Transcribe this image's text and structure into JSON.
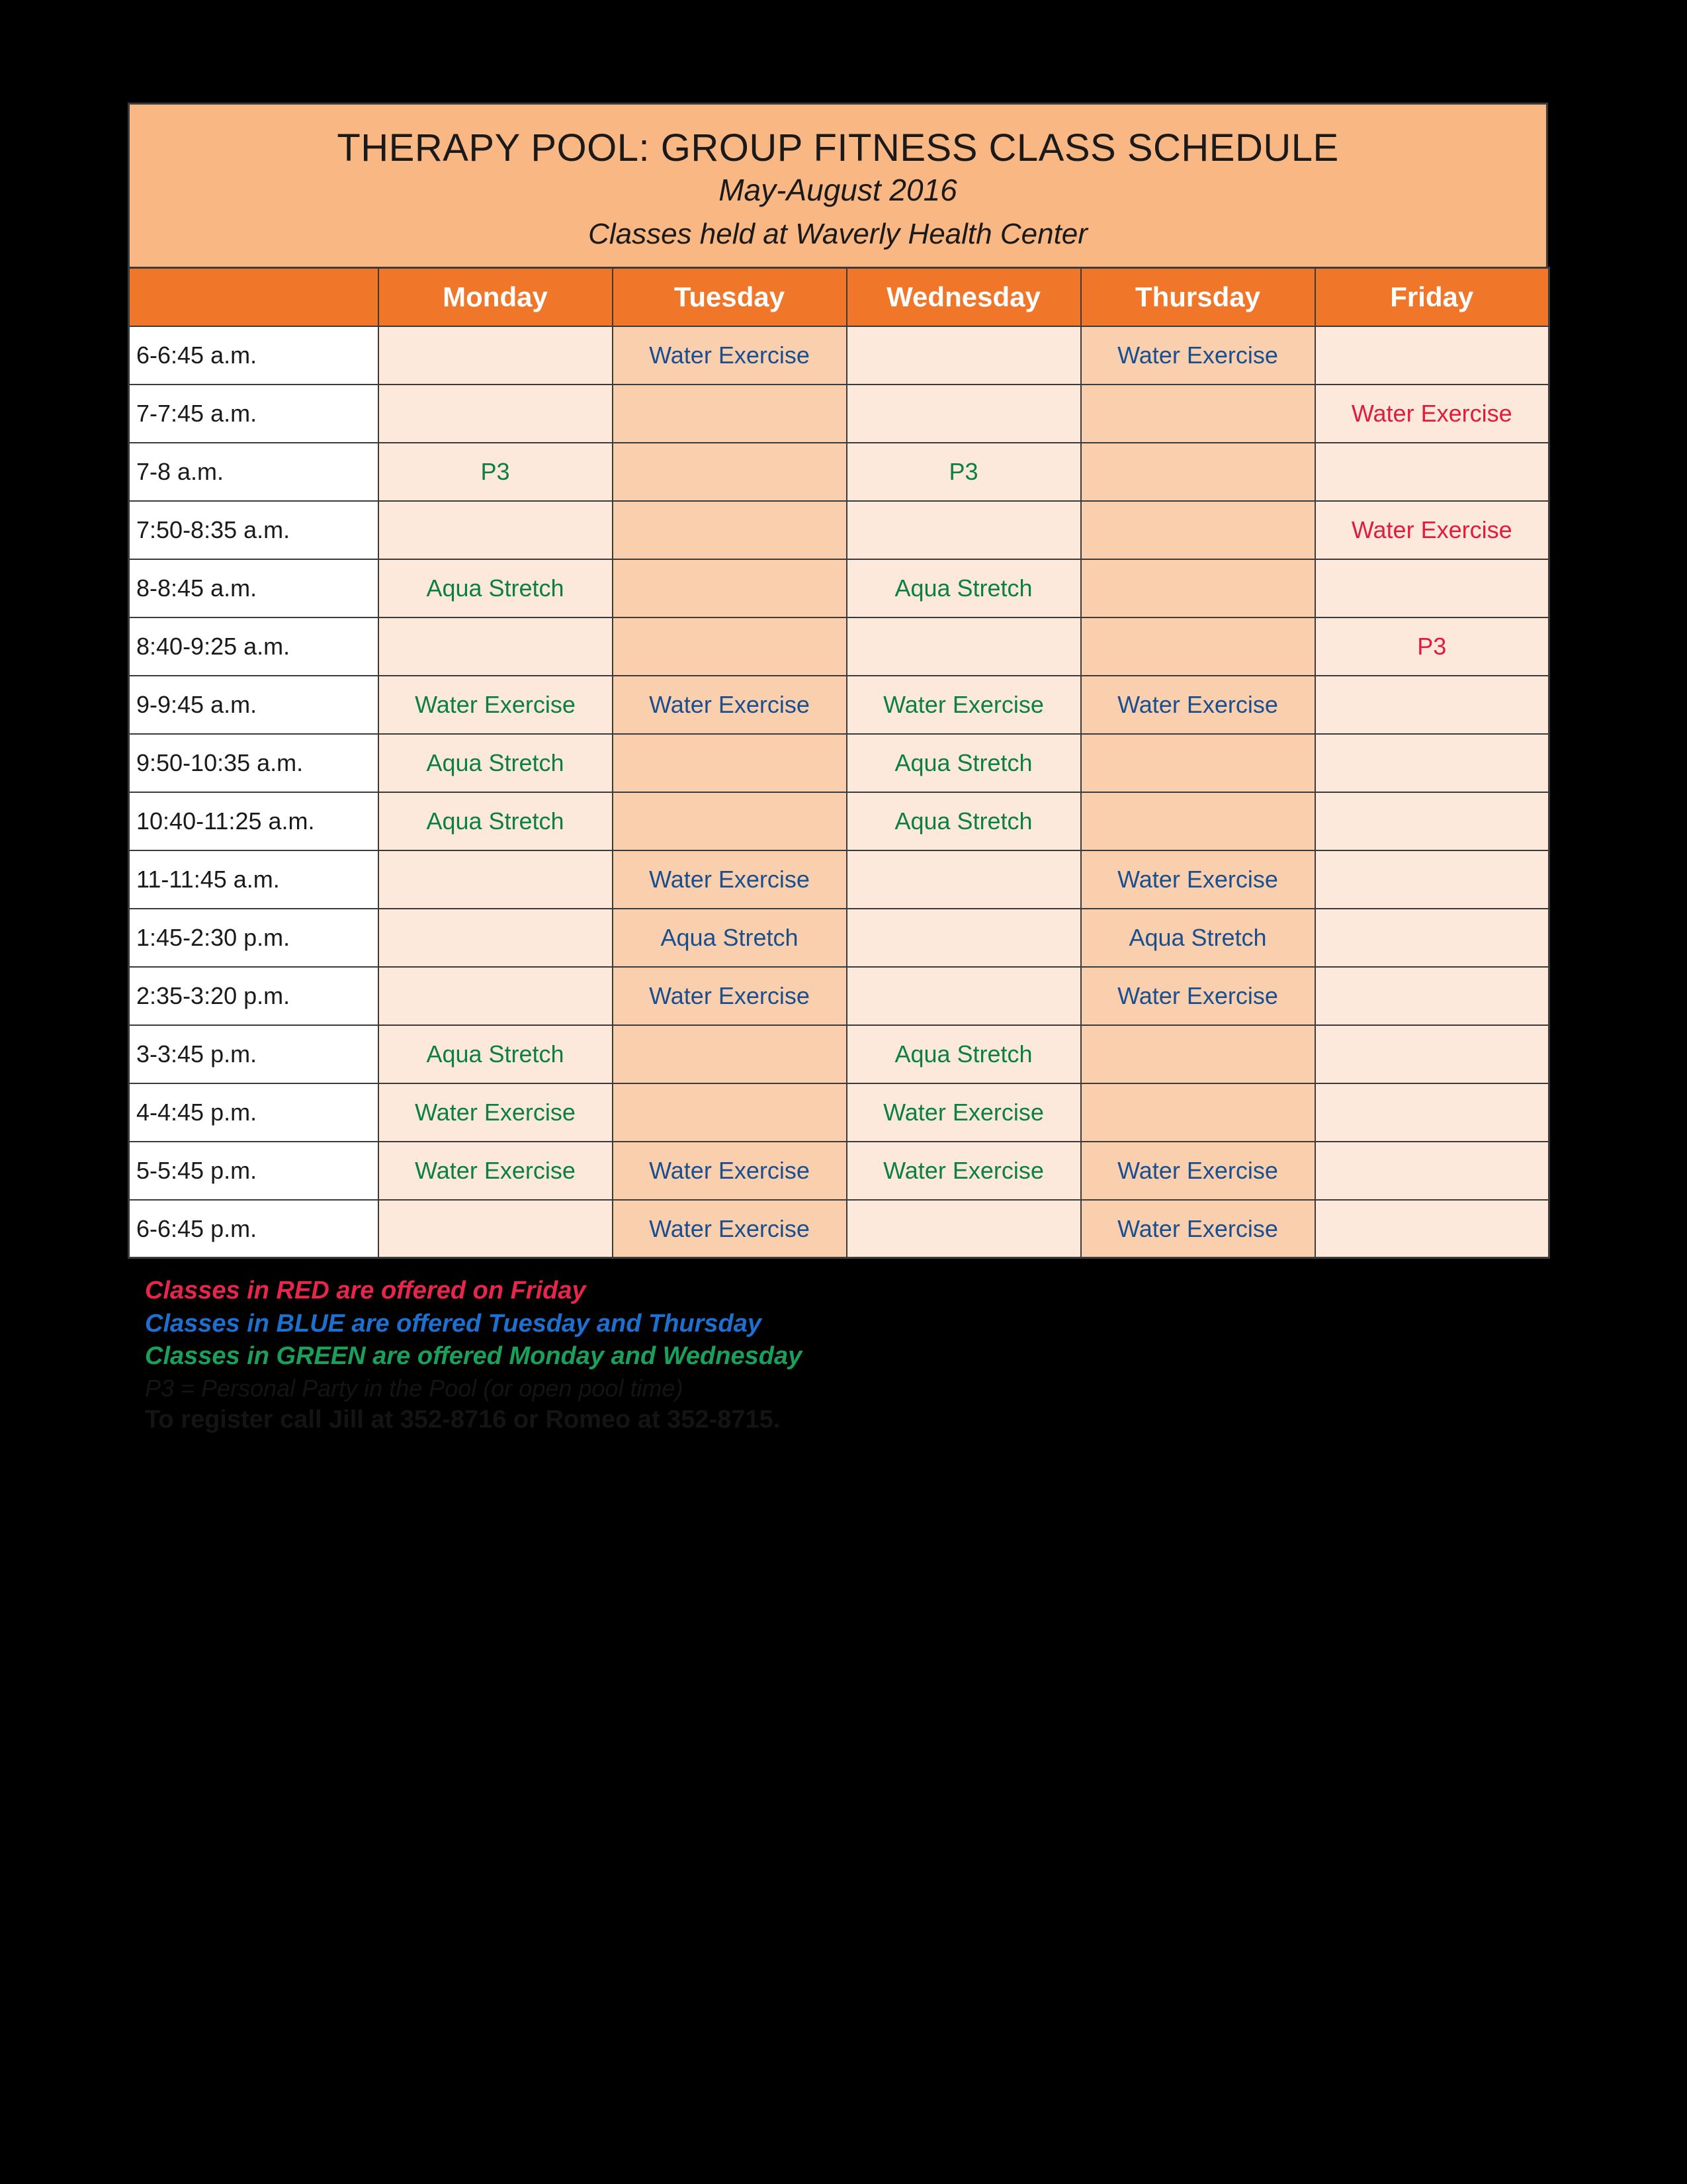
{
  "banner": {
    "title": "THERAPY POOL: GROUP FITNESS CLASS SCHEDULE",
    "subtitle": "May-August 2016",
    "location_line": "Classes held at Waverly Health Center"
  },
  "colors": {
    "banner_bg": "#F9B783",
    "header_bg": "#F0772A",
    "cell_light": "#FCE9DC",
    "cell_dark": "#FACFAE",
    "text_green": "#0B8040",
    "text_blue": "#1A4F8F",
    "text_red": "#E01B3C",
    "page_bg": "#000000"
  },
  "table": {
    "columns": [
      "",
      "Monday",
      "Tuesday",
      "Wednesday",
      "Thursday",
      "Friday"
    ],
    "rows": [
      {
        "time": "6-6:45 a.m.",
        "cells": [
          {
            "text": "",
            "color": ""
          },
          {
            "text": "Water Exercise",
            "color": "blue"
          },
          {
            "text": "",
            "color": ""
          },
          {
            "text": "Water Exercise",
            "color": "blue"
          },
          {
            "text": "",
            "color": ""
          }
        ]
      },
      {
        "time": "7-7:45 a.m.",
        "cells": [
          {
            "text": "",
            "color": ""
          },
          {
            "text": "",
            "color": ""
          },
          {
            "text": "",
            "color": ""
          },
          {
            "text": "",
            "color": ""
          },
          {
            "text": "Water Exercise",
            "color": "red"
          }
        ]
      },
      {
        "time": "7-8 a.m.",
        "cells": [
          {
            "text": "P3",
            "color": "green"
          },
          {
            "text": "",
            "color": ""
          },
          {
            "text": "P3",
            "color": "green"
          },
          {
            "text": "",
            "color": ""
          },
          {
            "text": "",
            "color": ""
          }
        ]
      },
      {
        "time": "7:50-8:35 a.m.",
        "cells": [
          {
            "text": "",
            "color": ""
          },
          {
            "text": "",
            "color": ""
          },
          {
            "text": "",
            "color": ""
          },
          {
            "text": "",
            "color": ""
          },
          {
            "text": "Water Exercise",
            "color": "red"
          }
        ]
      },
      {
        "time": "8-8:45 a.m.",
        "cells": [
          {
            "text": "Aqua Stretch",
            "color": "green"
          },
          {
            "text": "",
            "color": ""
          },
          {
            "text": "Aqua Stretch",
            "color": "green"
          },
          {
            "text": "",
            "color": ""
          },
          {
            "text": "",
            "color": ""
          }
        ]
      },
      {
        "time": "8:40-9:25 a.m.",
        "cells": [
          {
            "text": "",
            "color": ""
          },
          {
            "text": "",
            "color": ""
          },
          {
            "text": "",
            "color": ""
          },
          {
            "text": "",
            "color": ""
          },
          {
            "text": "P3",
            "color": "red"
          }
        ]
      },
      {
        "time": "9-9:45 a.m.",
        "cells": [
          {
            "text": "Water Exercise",
            "color": "green"
          },
          {
            "text": "Water Exercise",
            "color": "blue"
          },
          {
            "text": "Water Exercise",
            "color": "green"
          },
          {
            "text": "Water Exercise",
            "color": "blue"
          },
          {
            "text": "",
            "color": ""
          }
        ]
      },
      {
        "time": "9:50-10:35 a.m.",
        "cells": [
          {
            "text": "Aqua Stretch",
            "color": "green"
          },
          {
            "text": "",
            "color": ""
          },
          {
            "text": "Aqua Stretch",
            "color": "green"
          },
          {
            "text": "",
            "color": ""
          },
          {
            "text": "",
            "color": ""
          }
        ]
      },
      {
        "time": "10:40-11:25 a.m.",
        "cells": [
          {
            "text": "Aqua Stretch",
            "color": "green"
          },
          {
            "text": "",
            "color": ""
          },
          {
            "text": "Aqua Stretch",
            "color": "green"
          },
          {
            "text": "",
            "color": ""
          },
          {
            "text": "",
            "color": ""
          }
        ]
      },
      {
        "time": "11-11:45 a.m.",
        "cells": [
          {
            "text": "",
            "color": ""
          },
          {
            "text": "Water Exercise",
            "color": "blue"
          },
          {
            "text": "",
            "color": ""
          },
          {
            "text": "Water Exercise",
            "color": "blue"
          },
          {
            "text": "",
            "color": ""
          }
        ]
      },
      {
        "time": "1:45-2:30 p.m.",
        "cells": [
          {
            "text": "",
            "color": ""
          },
          {
            "text": "Aqua Stretch",
            "color": "blue"
          },
          {
            "text": "",
            "color": ""
          },
          {
            "text": "Aqua Stretch",
            "color": "blue"
          },
          {
            "text": "",
            "color": ""
          }
        ]
      },
      {
        "time": "2:35-3:20 p.m.",
        "cells": [
          {
            "text": "",
            "color": ""
          },
          {
            "text": "Water Exercise",
            "color": "blue"
          },
          {
            "text": "",
            "color": ""
          },
          {
            "text": "Water Exercise",
            "color": "blue"
          },
          {
            "text": "",
            "color": ""
          }
        ]
      },
      {
        "time": "3-3:45 p.m.",
        "cells": [
          {
            "text": "Aqua Stretch",
            "color": "green"
          },
          {
            "text": "",
            "color": ""
          },
          {
            "text": "Aqua Stretch",
            "color": "green"
          },
          {
            "text": "",
            "color": ""
          },
          {
            "text": "",
            "color": ""
          }
        ]
      },
      {
        "time": "4-4:45 p.m.",
        "cells": [
          {
            "text": "Water Exercise",
            "color": "green"
          },
          {
            "text": "",
            "color": ""
          },
          {
            "text": "Water Exercise",
            "color": "green"
          },
          {
            "text": "",
            "color": ""
          },
          {
            "text": "",
            "color": ""
          }
        ]
      },
      {
        "time": "5-5:45 p.m.",
        "cells": [
          {
            "text": "Water Exercise",
            "color": "green"
          },
          {
            "text": "Water Exercise",
            "color": "blue"
          },
          {
            "text": "Water Exercise",
            "color": "green"
          },
          {
            "text": "Water Exercise",
            "color": "blue"
          },
          {
            "text": "",
            "color": ""
          }
        ]
      },
      {
        "time": "6-6:45 p.m.",
        "cells": [
          {
            "text": "",
            "color": ""
          },
          {
            "text": "Water Exercise",
            "color": "blue"
          },
          {
            "text": "",
            "color": ""
          },
          {
            "text": "Water Exercise",
            "color": "blue"
          },
          {
            "text": "",
            "color": ""
          }
        ]
      }
    ]
  },
  "legend": {
    "red_line": "Classes in RED are offered on Friday",
    "blue_line": "Classes in BLUE are offered Tuesday and Thursday",
    "green_line": "Classes in GREEN are offered Monday and Wednesday",
    "p3_line": "P3 = Personal Party in the Pool (or open pool time)",
    "register_line": "To register call Jill at 352-8716 or Romeo at 352-8715."
  }
}
